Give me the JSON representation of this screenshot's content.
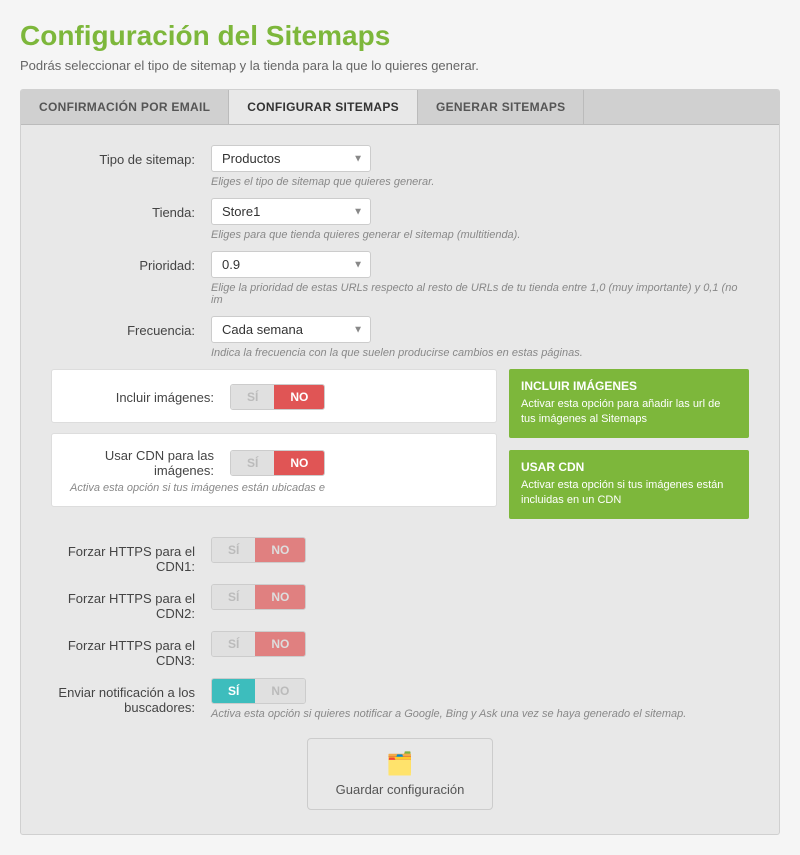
{
  "page": {
    "title": "Configuración del Sitemaps",
    "subtitle": "Podrás seleccionar el tipo de sitemap y la tienda para la que lo quieres generar."
  },
  "tabs": [
    {
      "id": "email",
      "label": "CONFIRMACIÓN POR EMAIL",
      "active": false
    },
    {
      "id": "configurar",
      "label": "CONFIGURAR SITEMAPS",
      "active": true
    },
    {
      "id": "generar",
      "label": "GENERAR SITEMAPS",
      "active": false
    }
  ],
  "form": {
    "tipo_label": "Tipo de sitemap:",
    "tipo_value": "Productos",
    "tipo_hint": "Eliges el tipo de sitemap que quieres generar.",
    "tienda_label": "Tienda:",
    "tienda_value": "Store1",
    "tienda_hint": "Eliges para que tienda quieres generar el sitemap (multitienda).",
    "prioridad_label": "Prioridad:",
    "prioridad_value": "0.9",
    "prioridad_hint": "Elige la prioridad de estas URLs respecto al resto de URLs de tu tienda entre 1,0 (muy importante) y 0,1 (no im",
    "frecuencia_label": "Frecuencia:",
    "frecuencia_value": "Cada semana",
    "frecuencia_hint": "Indica la frecuencia con la que suelen producirse cambios en estas páginas.",
    "incluir_label": "Incluir imágenes:",
    "usar_cdn_label": "Usar CDN para las imágenes:",
    "usar_cdn_hint": "Activa esta opción si tus imágenes están ubicadas e",
    "forzar_cdn1_label": "Forzar HTTPS para el CDN1:",
    "forzar_cdn2_label": "Forzar HTTPS para el CDN2:",
    "forzar_cdn3_label": "Forzar HTTPS para el CDN3:",
    "notificar_label": "Enviar notificación a los buscadores:",
    "notificar_hint": "Activa esta opción si quieres notificar a Google, Bing y Ask una vez se haya generado el sitemap.",
    "btn_si": "SÍ",
    "btn_no": "NO"
  },
  "callouts": {
    "incluir": {
      "title": "INCLUIR IMÁGENES",
      "text": "Activar esta opción para añadir las url de tus imágenes al Sitemaps"
    },
    "cdn": {
      "title": "USAR CDN",
      "text": "Activar esta opción si tus imágenes están incluidas en un CDN"
    }
  },
  "save": {
    "label": "Guardar configuración"
  }
}
